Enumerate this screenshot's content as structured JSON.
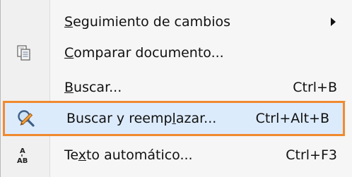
{
  "menu": {
    "items": [
      {
        "label_parts": [
          "",
          "S",
          "eguimiento de cambios"
        ],
        "label": "Seguimiento de cambios",
        "shortcut": "",
        "has_submenu": true,
        "icon": ""
      },
      {
        "label_parts": [
          "",
          "C",
          "omparar documento..."
        ],
        "label": "Comparar documento...",
        "shortcut": "",
        "has_submenu": false,
        "icon": "compare-document-icon"
      },
      {
        "label_parts": [
          "",
          "B",
          "uscar..."
        ],
        "label": "Buscar...",
        "shortcut": "Ctrl+B",
        "has_submenu": false,
        "icon": ""
      },
      {
        "label_parts": [
          "Buscar y reemp",
          "l",
          "azar..."
        ],
        "label": "Buscar y reemplazar...",
        "shortcut": "Ctrl+Alt+B",
        "has_submenu": false,
        "icon": "find-replace-icon",
        "highlighted": true,
        "highlight_color": "#f08a2e"
      },
      {
        "label_parts": [
          "Te",
          "x",
          "to automático..."
        ],
        "label": "Texto automático...",
        "shortcut": "Ctrl+F3",
        "has_submenu": false,
        "icon": "autotext-icon"
      }
    ]
  }
}
